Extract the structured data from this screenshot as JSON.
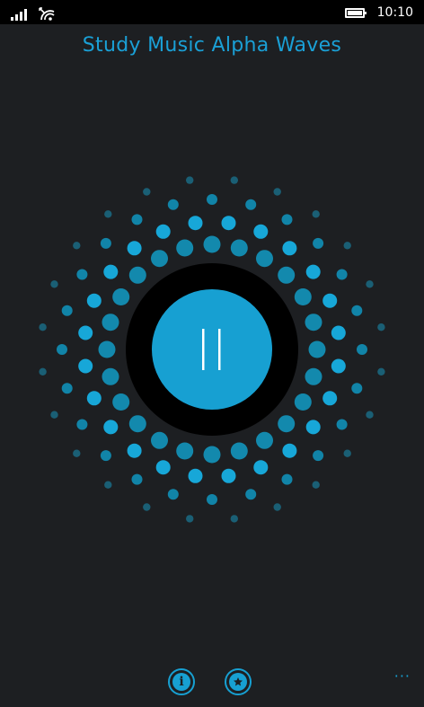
{
  "status_bar": {
    "time": "10:10",
    "signal_icon": "signal-bars-icon",
    "wifi_icon": "wifi-icon",
    "battery_icon": "battery-icon"
  },
  "app": {
    "title": "Study Music Alpha Waves"
  },
  "player": {
    "state_icon": "pause-icon",
    "accent_color": "#1aa0d6",
    "background_color": "#1d1f22",
    "ring_color": "#000000"
  },
  "app_bar": {
    "info_icon": "info-icon",
    "favorite_icon": "star-icon",
    "more_label": "···"
  }
}
